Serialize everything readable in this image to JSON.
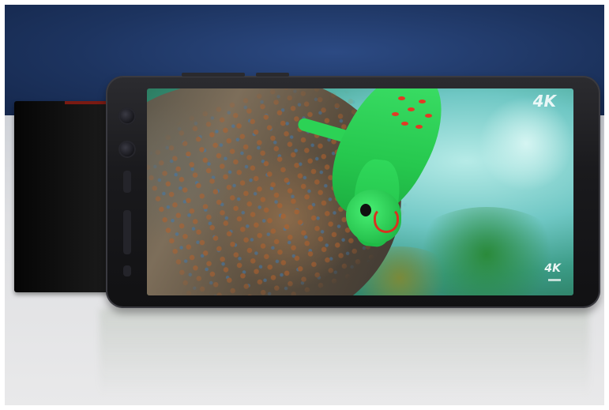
{
  "photo": {
    "subject": "smartphone-on-table",
    "screen_text": {
      "logo_top": "4K",
      "logo_bottom": "4K"
    },
    "colors": {
      "gecko": "#2fd85a",
      "background": "#1d3460",
      "table": "#dedfe2"
    }
  }
}
